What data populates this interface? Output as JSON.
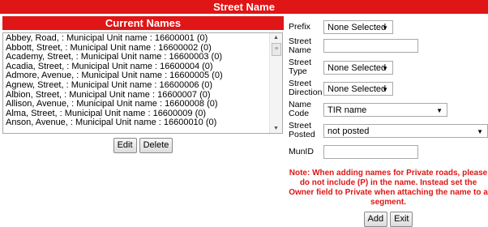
{
  "title": "Street Name",
  "names_panel": {
    "header": "Current Names",
    "items": [
      "Abbey, Road,   : Municipal Unit name : 16600001 (0)",
      "Abbott, Street,   : Municipal Unit name : 16600002 (0)",
      "Academy, Street,   : Municipal Unit name : 16600003 (0)",
      "Acadia, Street,   : Municipal Unit name : 16600004 (0)",
      "Admore, Avenue,   : Municipal Unit name : 16600005 (0)",
      "Agnew, Street,   : Municipal Unit name : 16600006 (0)",
      "Albion, Street,   : Municipal Unit name : 16600007 (0)",
      "Allison, Avenue,   : Municipal Unit name : 16600008 (0)",
      "Alma, Street,   : Municipal Unit name : 16600009 (0)",
      "Anson, Avenue,   : Municipal Unit name : 16600010 (0)"
    ],
    "edit_label": "Edit",
    "delete_label": "Delete"
  },
  "form": {
    "prefix": {
      "label": "Prefix",
      "value": "None Selected"
    },
    "street_name": {
      "label": "Street Name",
      "value": ""
    },
    "street_type": {
      "label": "Street Type",
      "value": "None Selected"
    },
    "street_direction": {
      "label": "Street Direction",
      "value": "None Selected"
    },
    "name_code": {
      "label": "Name Code",
      "value": "TIR name"
    },
    "street_posted": {
      "label": "Street Posted",
      "value": "not posted"
    },
    "munid": {
      "label": "MunID",
      "value": ""
    }
  },
  "note": "Note: When adding names for Private roads, please do not include (P) in the name. Instead set the Owner field to Private when attaching the name to a segment.",
  "add_label": "Add",
  "exit_label": "Exit",
  "accent_color": "#e01515"
}
